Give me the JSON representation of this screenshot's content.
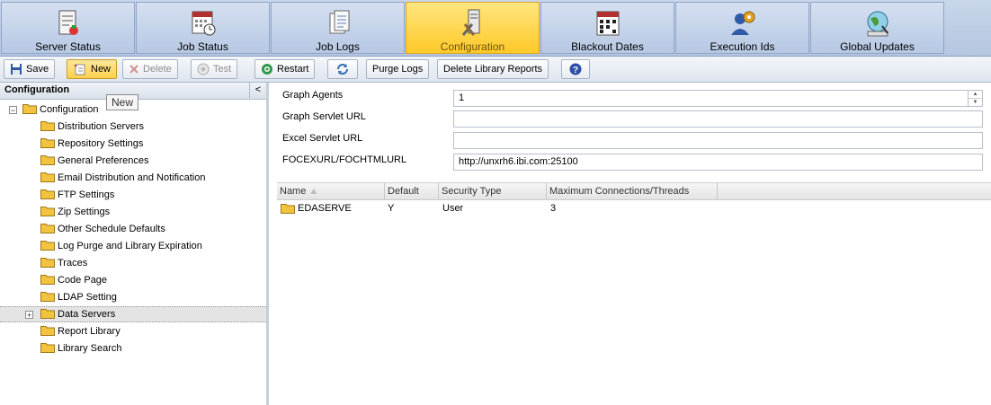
{
  "tabs": [
    {
      "label": "Server Status",
      "icon": "server-status-icon"
    },
    {
      "label": "Job Status",
      "icon": "job-status-icon"
    },
    {
      "label": "Job Logs",
      "icon": "job-logs-icon"
    },
    {
      "label": "Configuration",
      "icon": "configuration-icon",
      "active": true
    },
    {
      "label": "Blackout Dates",
      "icon": "calendar-icon"
    },
    {
      "label": "Execution Ids",
      "icon": "execution-ids-icon"
    },
    {
      "label": "Global Updates",
      "icon": "global-updates-icon"
    }
  ],
  "toolbar": {
    "save": "Save",
    "new": "New",
    "delete": "Delete",
    "test": "Test",
    "restart": "Restart",
    "purge_logs": "Purge Logs",
    "delete_library_reports": "Delete Library Reports"
  },
  "tooltip": "New",
  "left_panel": {
    "title": "Configuration",
    "collapse_glyph": "<",
    "root": "Configuration",
    "items": [
      "Distribution Servers",
      "Repository Settings",
      "General Preferences",
      "Email Distribution and Notification",
      "FTP Settings",
      "Zip Settings",
      "Other Schedule Defaults",
      "Log Purge and Library Expiration",
      "Traces",
      "Code Page",
      "LDAP Setting",
      "Data Servers",
      "Report Library",
      "Library Search"
    ]
  },
  "form": {
    "graph_agents_label": "Graph Agents",
    "graph_agents_value": "1",
    "graph_servlet_url_label": "Graph Servlet URL",
    "graph_servlet_url_value": "",
    "excel_servlet_url_label": "Excel Servlet URL",
    "excel_servlet_url_value": "",
    "focexurl_label": "FOCEXURL/FOCHTMLURL",
    "focexurl_value": "http://unxrh6.ibi.com:25100"
  },
  "grid": {
    "columns": [
      "Name",
      "Default",
      "Security Type",
      "Maximum Connections/Threads"
    ],
    "rows": [
      {
        "name": "EDASERVE",
        "default": "Y",
        "security_type": "User",
        "max_connections": "3"
      }
    ]
  },
  "colors": {
    "active_tab": "#ffc928",
    "tab_bg": "#b7c8e3",
    "folder": "#f2c33e"
  }
}
